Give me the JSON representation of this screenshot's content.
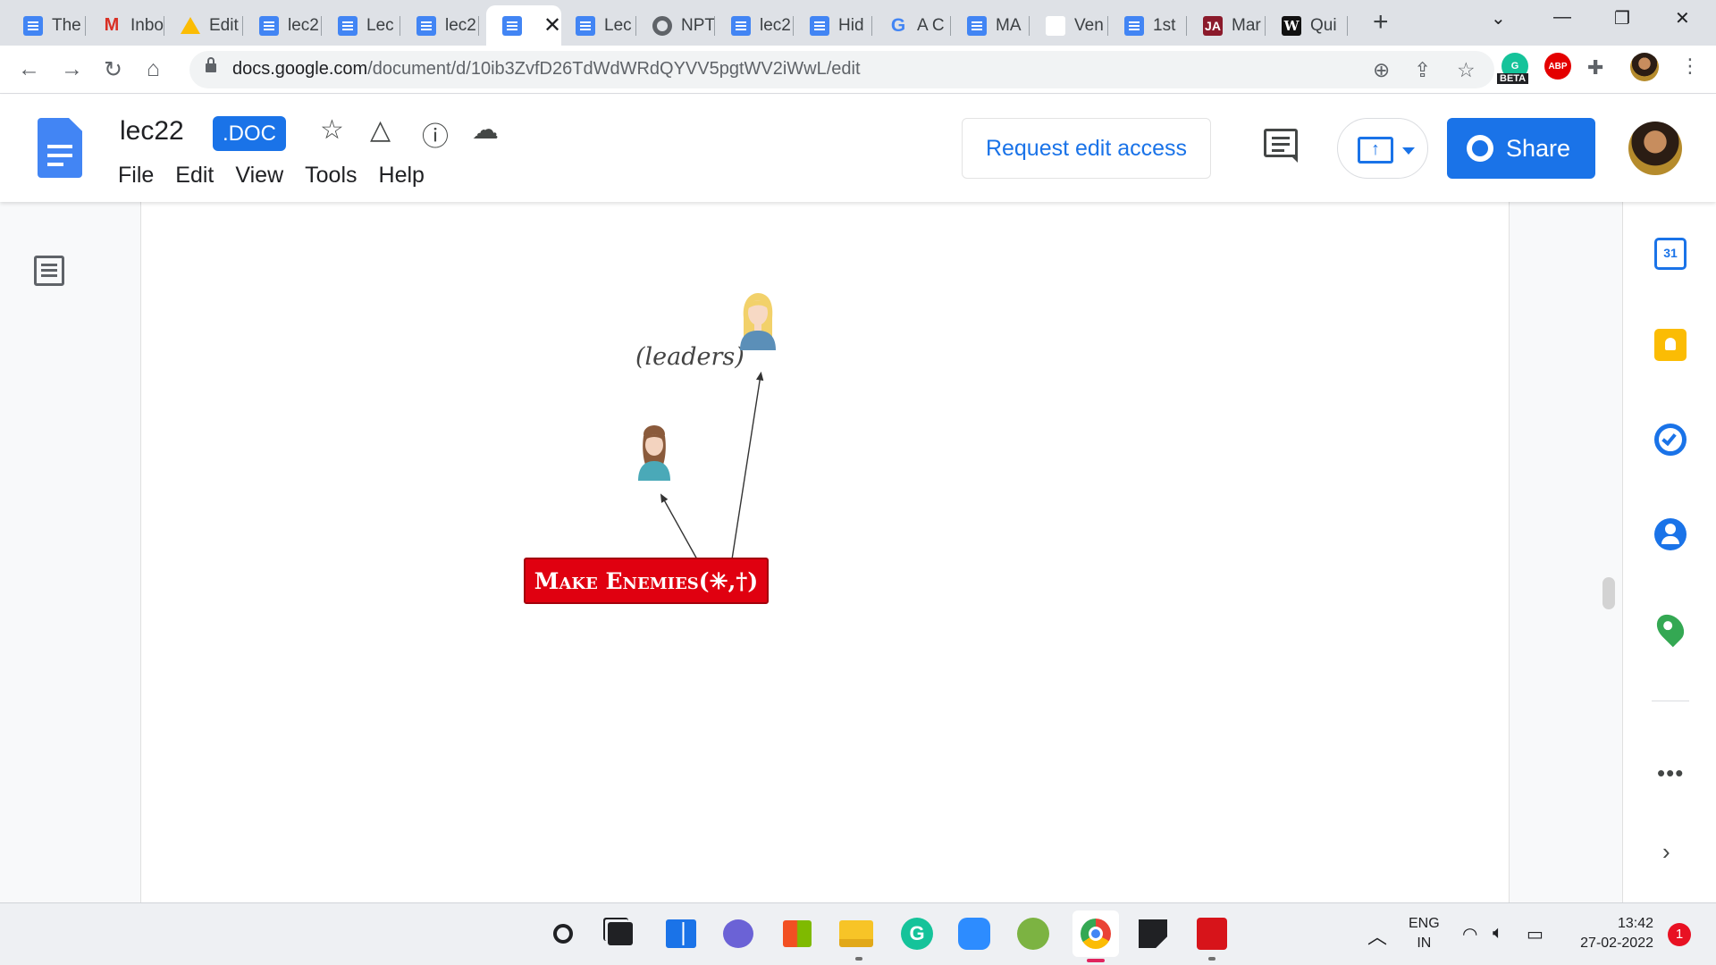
{
  "browser": {
    "tabs": [
      {
        "label": "The",
        "icon": "docs-icon"
      },
      {
        "label": "Inbo",
        "icon": "gmail-icon"
      },
      {
        "label": "Edit",
        "icon": "drive-icon"
      },
      {
        "label": "lec2",
        "icon": "docs-icon"
      },
      {
        "label": "Lec",
        "icon": "docs-icon"
      },
      {
        "label": "lec2",
        "icon": "docs-icon"
      },
      {
        "label": "",
        "icon": "docs-icon",
        "active": true
      },
      {
        "label": "Lec",
        "icon": "docs-icon"
      },
      {
        "label": "NPT",
        "icon": "globe-icon"
      },
      {
        "label": "lec2",
        "icon": "docs-icon"
      },
      {
        "label": "Hid",
        "icon": "docs-icon"
      },
      {
        "label": "A C",
        "icon": "google-icon"
      },
      {
        "label": "MA",
        "icon": "docs-icon"
      },
      {
        "label": "Ven",
        "icon": "blank-page-icon"
      },
      {
        "label": "1st",
        "icon": "docs-icon"
      },
      {
        "label": "Mar",
        "icon": "ja-icon"
      },
      {
        "label": "Qui",
        "icon": "w-icon"
      }
    ],
    "close_tab_glyph": "✕",
    "new_tab_glyph": "+",
    "url": {
      "host": "docs.google.com",
      "path": "/document/d/10ib3ZvfD26TdWdWRdQYVV5pgtWV2iWwL/edit"
    },
    "beta_badge": "BETA",
    "abp_label": "ABP"
  },
  "docs": {
    "title": "lec22",
    "file_badge": ".DOC",
    "menus": [
      "File",
      "Edit",
      "View",
      "Tools",
      "Help"
    ],
    "request_edit_label": "Request edit access",
    "share_label": "Share",
    "brand_blue": "#1a73e8"
  },
  "page": {
    "leaders_label": "(leaders)",
    "make_enemies_label": "Make Enemies(✳,†)",
    "box_color": "#e00010"
  },
  "side_panel": {
    "calendar_day": "31",
    "more_glyph": "•••",
    "chevron_glyph": "›"
  },
  "taskbar": {
    "lang_top": "ENG",
    "lang_bottom": "IN",
    "time": "13:42",
    "date": "27-02-2022",
    "notifications": "1"
  }
}
